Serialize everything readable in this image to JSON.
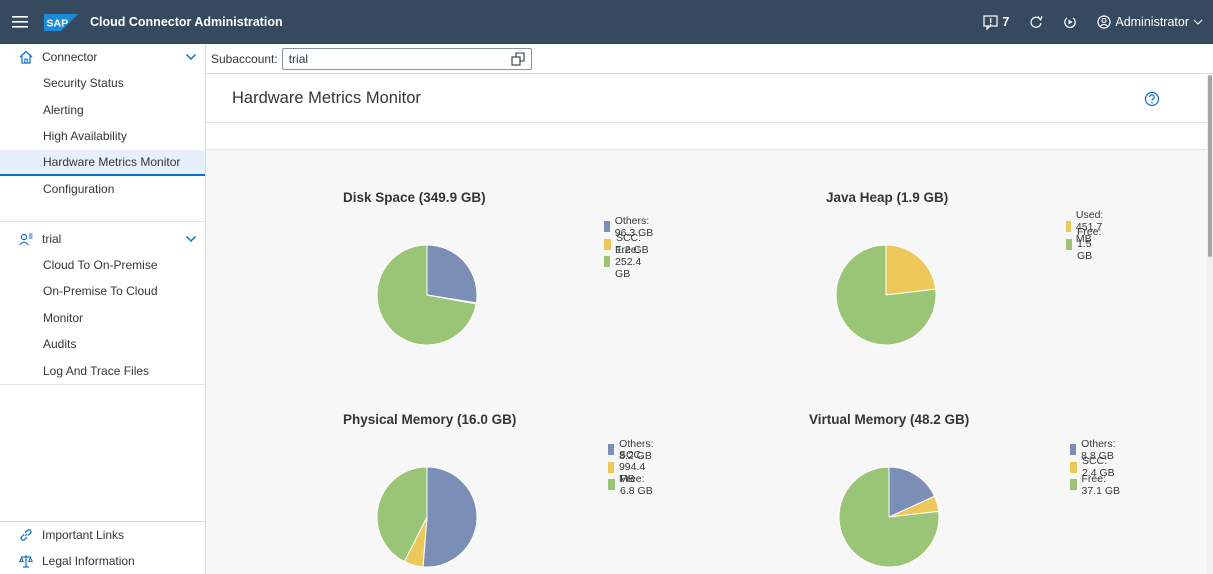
{
  "app": {
    "title": "Cloud Connector Administration",
    "logo_text": "SAP"
  },
  "shell": {
    "notifications_count": "7",
    "user": "Administrator",
    "icons": [
      "menu-icon",
      "notification-icon",
      "refresh-icon",
      "logout-icon",
      "user-icon",
      "chevron-down-icon"
    ]
  },
  "sidebar": {
    "connector": {
      "label": "Connector",
      "items": [
        "Security Status",
        "Alerting",
        "High Availability",
        "Hardware Metrics Monitor",
        "Configuration"
      ],
      "active": "Hardware Metrics Monitor"
    },
    "subaccount": {
      "label": "trial",
      "items": [
        "Cloud To On-Premise",
        "On-Premise To Cloud",
        "Monitor",
        "Audits",
        "Log And Trace Files"
      ]
    },
    "bottom": [
      "Important Links",
      "Legal Information"
    ]
  },
  "subaccount_bar": {
    "label": "Subaccount:",
    "value": "trial"
  },
  "page": {
    "title": "Hardware Metrics Monitor"
  },
  "colors": {
    "others": "#7b8fb6",
    "scc": "#ecc75a",
    "free": "#9ac576",
    "shell": "#354a5f",
    "accent": "#0a6ed1"
  },
  "chart_data": [
    {
      "type": "pie",
      "title": "Disk Space (349.9 GB)",
      "labels": [
        "Others",
        "SCC",
        "Free"
      ],
      "values": [
        96.3,
        1.2,
        252.4
      ],
      "legend": [
        "Others: 96.3 GB",
        "SCC: 1.2 GB",
        "Free: 252.4 GB"
      ]
    },
    {
      "type": "pie",
      "title": "Java Heap (1.9 GB)",
      "labels": [
        "Used",
        "Free"
      ],
      "values": [
        0.4517,
        1.5
      ],
      "legend": [
        "Used: 451.7 MB",
        "Free: 1.5 GB"
      ]
    },
    {
      "type": "pie",
      "title": "Physical Memory (16.0 GB)",
      "labels": [
        "Others",
        "SCC",
        "Free"
      ],
      "values": [
        8.2,
        0.9944,
        6.8
      ],
      "legend": [
        "Others: 8.2 GB",
        "SCC: 994.4 MB",
        "Free: 6.8 GB"
      ]
    },
    {
      "type": "pie",
      "title": "Virtual Memory (48.2 GB)",
      "labels": [
        "Others",
        "SCC",
        "Free"
      ],
      "values": [
        8.8,
        2.4,
        37.1
      ],
      "legend": [
        "Others: 8.8 GB",
        "SCC: 2.4 GB",
        "Free: 37.1 GB"
      ]
    }
  ]
}
